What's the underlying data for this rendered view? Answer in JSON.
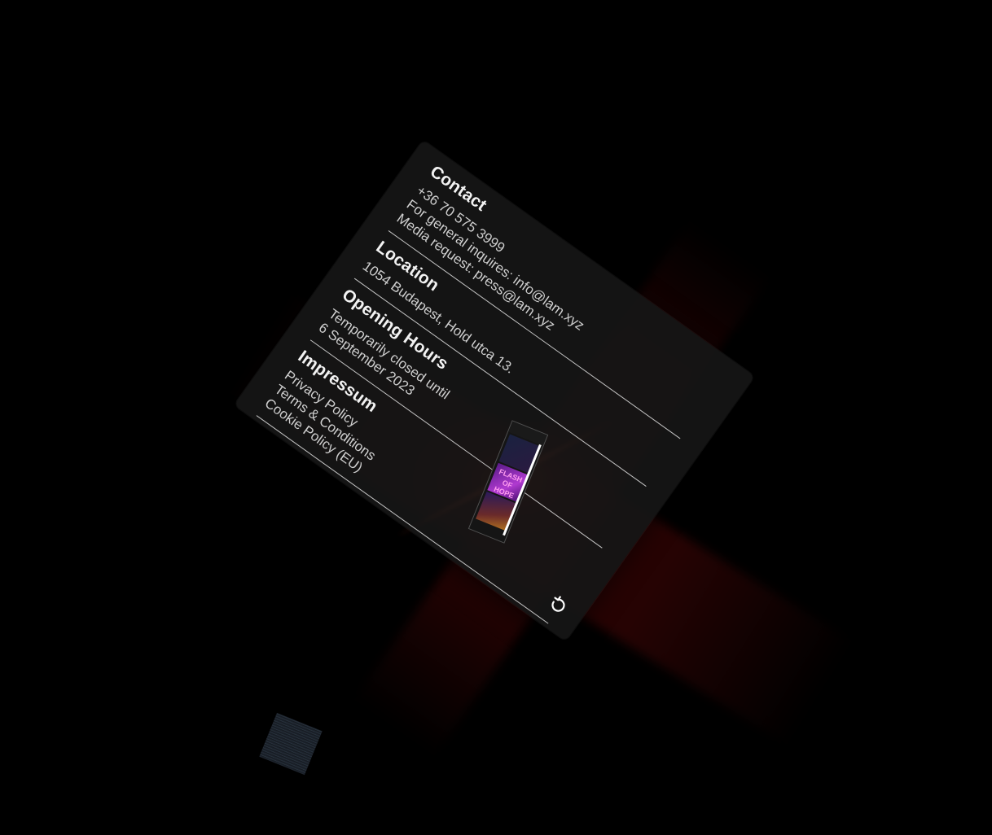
{
  "contact": {
    "heading": "Contact",
    "phone": "+36 70 575 3999",
    "general": "For general inquires: info@lam.xyz",
    "media": "Media request: press@lam.xyz"
  },
  "location": {
    "heading": "Location",
    "address": "1054 Budapest, Hold utca 13."
  },
  "hours": {
    "heading": "Opening Hours",
    "line1": "Temporarily closed until",
    "line2": "6 September 2023"
  },
  "impressum": {
    "heading": "Impressum",
    "links": [
      "Privacy Policy",
      "Terms & Conditions",
      "Cookie Policy (EU)"
    ]
  },
  "thumbnail": {
    "poster_text": "FLASH OF HOPE"
  },
  "colors": {
    "background": "#000000",
    "panel": "#161616",
    "glow": "#d8281a"
  },
  "icons": {
    "reset": "reset-icon"
  }
}
